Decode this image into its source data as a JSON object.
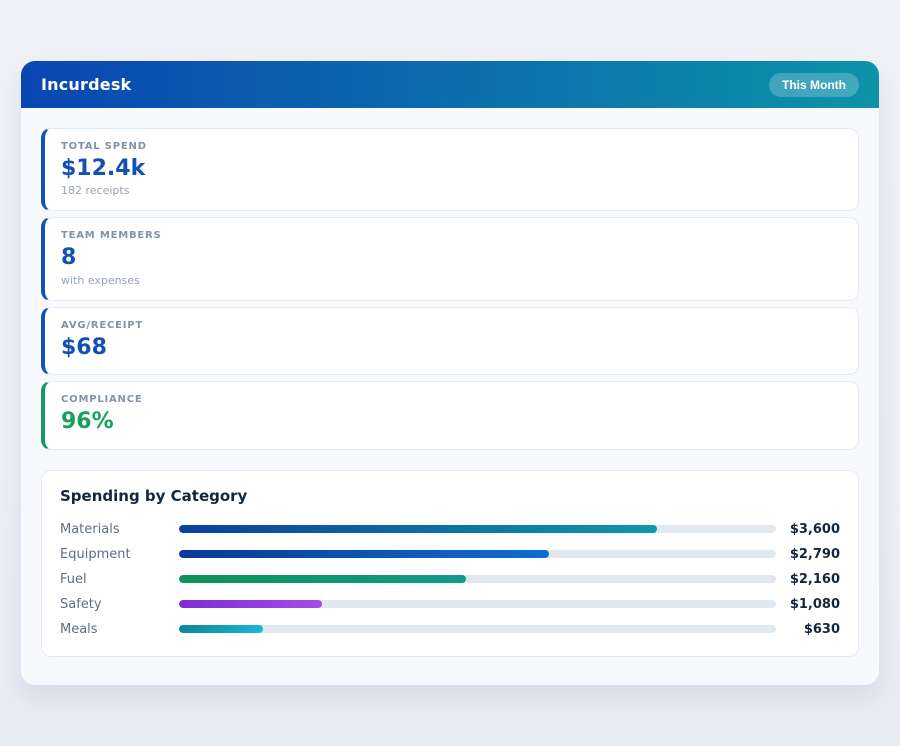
{
  "header": {
    "title": "Incurdesk",
    "badge_label": "This Month",
    "gradient_from": "#0a46b2",
    "gradient_to": "#0d93a8"
  },
  "stats": [
    {
      "label": "TOTAL SPEND",
      "value": "$12.4k",
      "sub": "182 receipts",
      "accent": "#1251b5",
      "value_color": "#1450b4"
    },
    {
      "label": "TEAM MEMBERS",
      "value": "8",
      "sub": "with expenses",
      "accent": "#1251b5",
      "value_color": "#1450b4"
    },
    {
      "label": "AVG/RECEIPT",
      "value": "$68",
      "sub": "",
      "accent": "#1251b5",
      "value_color": "#1450b4"
    },
    {
      "label": "COMPLIANCE",
      "value": "96%",
      "sub": "",
      "accent": "#16995c",
      "value_color": "#16a05a"
    }
  ],
  "categories": {
    "title": "Spending by Category",
    "track_color": "#e2e8f0",
    "rows": [
      {
        "label": "Materials",
        "value": "$3,600",
        "pct": 80,
        "from": "#0b3f9e",
        "to": "#0e98a8"
      },
      {
        "label": "Equipment",
        "value": "$2,790",
        "pct": 62,
        "from": "#0a3a96",
        "to": "#0d6fd0"
      },
      {
        "label": "Fuel",
        "value": "$2,160",
        "pct": 48,
        "from": "#0f9256",
        "to": "#109a8c"
      },
      {
        "label": "Safety",
        "value": "$1,080",
        "pct": 24,
        "from": "#7f2bd8",
        "to": "#a34ce6"
      },
      {
        "label": "Meals",
        "value": "$630",
        "pct": 14,
        "from": "#0d8596",
        "to": "#1ab8d8"
      }
    ]
  },
  "chart_data": {
    "type": "bar",
    "orientation": "horizontal",
    "title": "Spending by Category",
    "categories": [
      "Materials",
      "Equipment",
      "Fuel",
      "Safety",
      "Meals"
    ],
    "values": [
      3600,
      2790,
      2160,
      1080,
      630
    ],
    "value_labels": [
      "$3,600",
      "$2,790",
      "$2,160",
      "$1,080",
      "$630"
    ],
    "xlim": [
      0,
      4500
    ],
    "grid": false,
    "legend": false
  }
}
